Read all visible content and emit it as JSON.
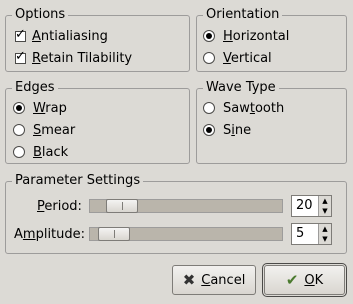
{
  "options": {
    "title": "Options",
    "antialiasing": {
      "label_u": "A",
      "label_rest": "ntialiasing",
      "checked": true
    },
    "retain_tilability": {
      "label_u": "R",
      "label_rest": "etain Tilability",
      "checked": true
    }
  },
  "orientation": {
    "title": "Orientation",
    "horizontal": {
      "label_u": "H",
      "label_rest": "orizontal",
      "selected": true
    },
    "vertical": {
      "label_u": "V",
      "label_rest": "ertical",
      "selected": false
    }
  },
  "edges": {
    "title": "Edges",
    "wrap": {
      "label_u": "W",
      "label_rest": "rap",
      "selected": true
    },
    "smear": {
      "label_u": "S",
      "label_rest": "mear",
      "selected": false
    },
    "black": {
      "label_u": "B",
      "label_rest": "lack",
      "selected": false
    }
  },
  "wave_type": {
    "title": "Wave Type",
    "sawtooth": {
      "label_pre": "Saw",
      "label_u": "t",
      "label_rest": "ooth",
      "selected": false
    },
    "sine": {
      "label_pre": "S",
      "label_u": "i",
      "label_rest": "ne",
      "selected": true
    }
  },
  "parameters": {
    "title": "Parameter Settings",
    "period": {
      "label_u": "P",
      "label_rest": "eriod:",
      "value": "20",
      "level": 0.1
    },
    "amplitude": {
      "label_pre": "A",
      "label_u": "m",
      "label_rest": "plitude:",
      "value": "5",
      "level": 0.05
    }
  },
  "buttons": {
    "cancel": {
      "label_u": "C",
      "label_rest": "ancel",
      "icon": "cancel-x-icon"
    },
    "ok": {
      "label_u": "O",
      "label_rest": "K",
      "icon": "ok-check-icon"
    }
  }
}
